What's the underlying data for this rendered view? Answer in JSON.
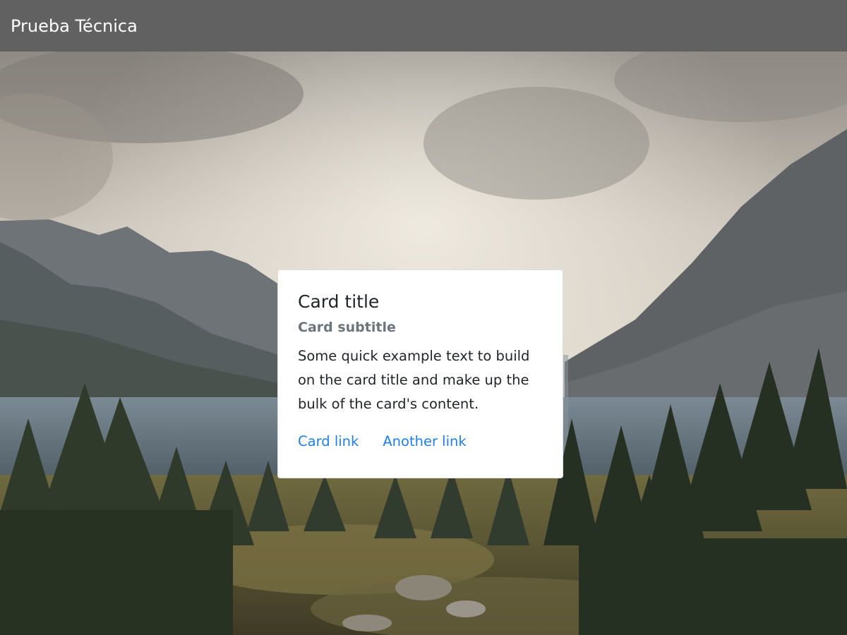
{
  "navbar": {
    "brand": "Prueba Técnica"
  },
  "hero": {
    "image": "mountain-lake-forest-landscape"
  },
  "card": {
    "title": "Card title",
    "subtitle": "Card subtitle",
    "text": "Some quick example text to build on the card title and make up the bulk of the card's content.",
    "links": [
      {
        "label": "Card link"
      },
      {
        "label": "Another link"
      }
    ]
  },
  "colors": {
    "navbar_bg": "#616161",
    "link": "#1e7ef2",
    "subtitle": "#6c757d",
    "text": "#212529"
  }
}
